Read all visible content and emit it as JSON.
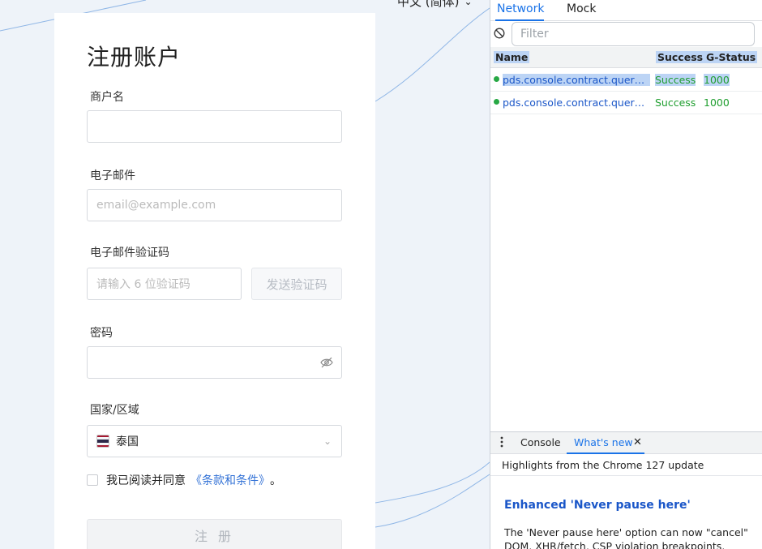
{
  "language": {
    "selected": "中文 (简体)"
  },
  "register": {
    "title": "注册账户",
    "merchant_label": "商户名",
    "merchant_value": "",
    "email_label": "电子邮件",
    "email_placeholder": "email@example.com",
    "code_label": "电子邮件验证码",
    "code_placeholder": "请输入 6 位验证码",
    "send_code": "发送验证码",
    "password_label": "密码",
    "region_label": "国家/区域",
    "region_value": "泰国",
    "agree_text": "我已阅读并同意",
    "terms_link": "《条款和条件》",
    "agree_suffix": "。",
    "submit": "注 册"
  },
  "devtools": {
    "tabs": [
      "Network",
      "Mock"
    ],
    "filter_placeholder": "Filter",
    "columns": [
      "Name",
      "Success",
      "G-Status"
    ],
    "rows": [
      {
        "name": "pds.console.contract.queryCa…",
        "success": "Success",
        "gstatus": "1000"
      },
      {
        "name": "pds.console.contract.queryCa…",
        "success": "Success",
        "gstatus": "1000"
      }
    ],
    "drawer_tabs": [
      "Console",
      "What's new"
    ],
    "highlights": "Highlights from the Chrome 127 update",
    "feature_title": "Enhanced 'Never pause here'",
    "feature_text": "The 'Never pause here' option can now \"cancel\" DOM, XHR/fetch, CSP violation breakpoints, exceptions and"
  },
  "colors": {
    "accent": "#1a73e8",
    "link": "#3372d6",
    "success": "#1f9e2f"
  }
}
